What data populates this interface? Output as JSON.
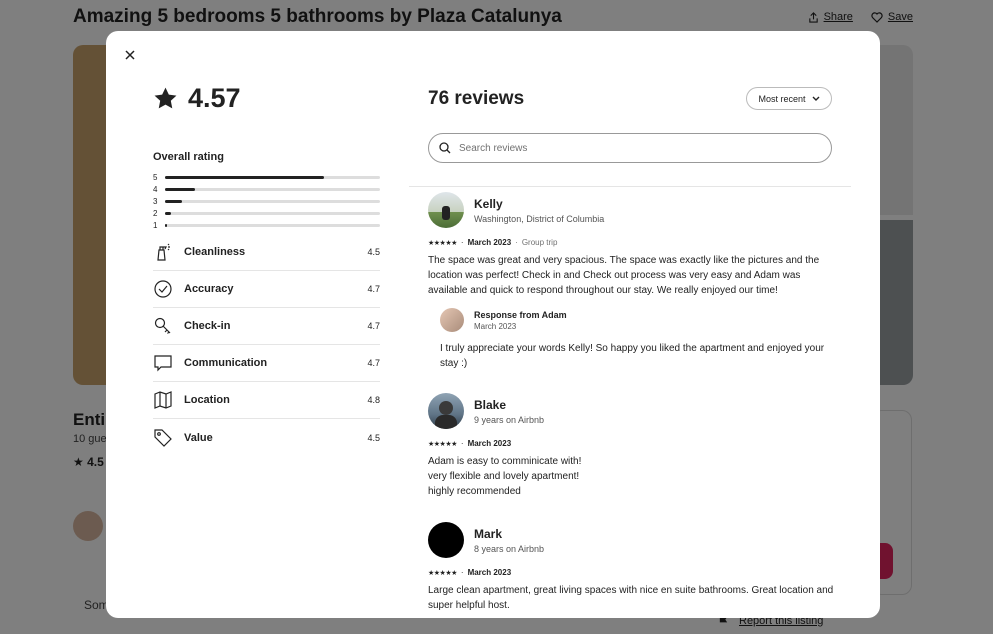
{
  "background": {
    "title": "Amazing 5 bedrooms 5 bathrooms by Plaza Catalunya",
    "share_label": "Share",
    "save_label": "Save",
    "entire_label": "Enti",
    "guests_label": "10 gue",
    "rating_label": "★ 4.5",
    "some_label": "Som",
    "report_label": "Report this listing"
  },
  "modal": {
    "overall_score": "4.57",
    "overall_label": "Overall rating",
    "distribution": [
      {
        "stars": "5",
        "fraction": 0.74
      },
      {
        "stars": "4",
        "fraction": 0.14
      },
      {
        "stars": "3",
        "fraction": 0.08
      },
      {
        "stars": "2",
        "fraction": 0.03
      },
      {
        "stars": "1",
        "fraction": 0.01
      }
    ],
    "categories": [
      {
        "label": "Cleanliness",
        "score": "4.5",
        "icon": "spray-bottle-icon"
      },
      {
        "label": "Accuracy",
        "score": "4.7",
        "icon": "check-circle-icon"
      },
      {
        "label": "Check-in",
        "score": "4.7",
        "icon": "key-icon"
      },
      {
        "label": "Communication",
        "score": "4.7",
        "icon": "chat-bubble-icon"
      },
      {
        "label": "Location",
        "score": "4.8",
        "icon": "map-icon"
      },
      {
        "label": "Value",
        "score": "4.5",
        "icon": "tag-icon"
      }
    ],
    "reviews_count": "76 reviews",
    "sort_label": "Most recent",
    "search_placeholder": "Search reviews",
    "reviews": [
      {
        "name": "Kelly",
        "sub": "Washington, District of Columbia",
        "stars": "★★★★★",
        "date": "March 2023",
        "trip": "Group trip",
        "text": "The space was great and very spacious. The space was exactly like the pictures and the location was perfect! Check in and Check out process was very easy and Adam was available and quick to respond throughout our stay. We really enjoyed our time!",
        "response": {
          "title": "Response from Adam",
          "date": "March 2023",
          "text": "I truly appreciate your words Kelly! So happy you liked the apartment and enjoyed your stay :)"
        }
      },
      {
        "name": "Blake",
        "sub": "9 years on Airbnb",
        "stars": "★★★★★",
        "date": "March 2023",
        "text_lines": [
          "Adam is easy to comminicate with!",
          "very flexible and lovely apartment!",
          "highly recommended"
        ]
      },
      {
        "name": "Mark",
        "sub": "8 years on Airbnb",
        "stars": "★★★★★",
        "date": "March 2023",
        "text": "Large clean apartment, great living spaces with nice en suite bathrooms. Great location and super helpful host."
      }
    ]
  }
}
